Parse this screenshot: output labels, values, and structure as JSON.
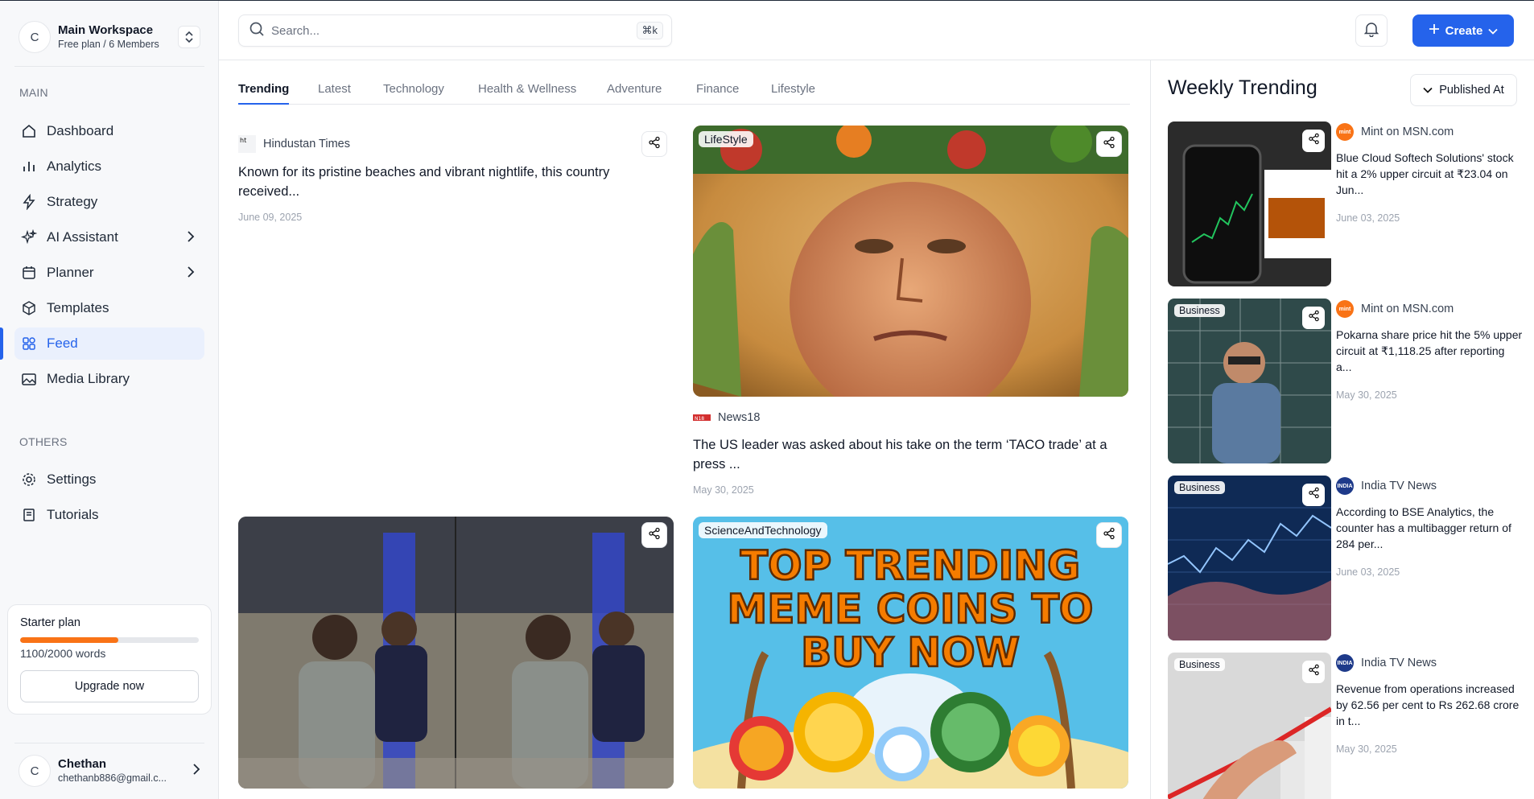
{
  "workspace": {
    "initial": "C",
    "name": "Main Workspace",
    "plan": "Free plan / 6 Members"
  },
  "sidebar": {
    "main_label": "MAIN",
    "others_label": "OTHERS",
    "items": [
      {
        "label": "Dashboard",
        "icon": "home-icon"
      },
      {
        "label": "Analytics",
        "icon": "bar-chart-icon"
      },
      {
        "label": "Strategy",
        "icon": "lightning-icon"
      },
      {
        "label": "AI Assistant",
        "icon": "sparkles-icon"
      },
      {
        "label": "Planner",
        "icon": "calendar-icon"
      },
      {
        "label": "Templates",
        "icon": "box-icon"
      },
      {
        "label": "Feed",
        "icon": "grid-icon"
      },
      {
        "label": "Media Library",
        "icon": "image-icon"
      }
    ],
    "other_items": [
      {
        "label": "Settings",
        "icon": "gear-icon"
      },
      {
        "label": "Tutorials",
        "icon": "book-icon"
      }
    ]
  },
  "plan": {
    "title": "Starter plan",
    "words": "1100/2000 words",
    "progress": 0.55,
    "upgrade_label": "Upgrade now"
  },
  "user": {
    "initial": "C",
    "name": "Chethan",
    "email": "chethanb886@gmail.c..."
  },
  "search": {
    "placeholder": "Search...",
    "shortcut": "⌘k"
  },
  "header": {
    "create_label": "Create"
  },
  "tabs": [
    "Trending",
    "Latest",
    "Technology",
    "Health & Wellness",
    "Adventure",
    "Finance",
    "Lifestyle"
  ],
  "feed": [
    {
      "source": "Hindustan Times",
      "title": "Known for its pristine beaches and vibrant nightlife, this country received...",
      "date": "June 09, 2025"
    },
    {
      "tag": "LifeStyle",
      "source": "News18",
      "title": "The US leader was asked about his take on the term ‘TACO trade’ at a press ...",
      "date": "May 30, 2025"
    },
    {
      "tag": ""
    },
    {
      "tag": "ScienceAndTechnology",
      "banner": [
        "TOP TRENDING",
        "MEME COINS TO",
        "BUY NOW"
      ]
    }
  ],
  "weekly": {
    "title": "Weekly Trending",
    "filter_label": "Published At",
    "items": [
      {
        "tag": "",
        "source": "Mint on MSN.com",
        "logo_text": "mint",
        "logo_color": "#f97316",
        "title": "Blue Cloud Softech Solutions' stock hit a 2% upper circuit at ₹23.04 on Jun...",
        "date": "June 03, 2025"
      },
      {
        "tag": "Business",
        "source": "Mint on MSN.com",
        "logo_text": "mint",
        "logo_color": "#f97316",
        "title": "Pokarna share price hit the 5% upper circuit at ₹1,118.25 after reporting a...",
        "date": "May 30, 2025"
      },
      {
        "tag": "Business",
        "source": "India TV News",
        "logo_text": "INDIA",
        "logo_color": "#1e3a8a",
        "title": "According to BSE Analytics, the counter has a multibagger return of 284 per...",
        "date": "June 03, 2025"
      },
      {
        "tag": "Business",
        "source": "India TV News",
        "logo_text": "INDIA",
        "logo_color": "#1e3a8a",
        "title": "Revenue from operations increased by 62.56 per cent to Rs 262.68 crore in t...",
        "date": "May 30, 2025"
      }
    ]
  },
  "colors": {
    "accent": "#2563eb",
    "progress": "#f97316"
  }
}
